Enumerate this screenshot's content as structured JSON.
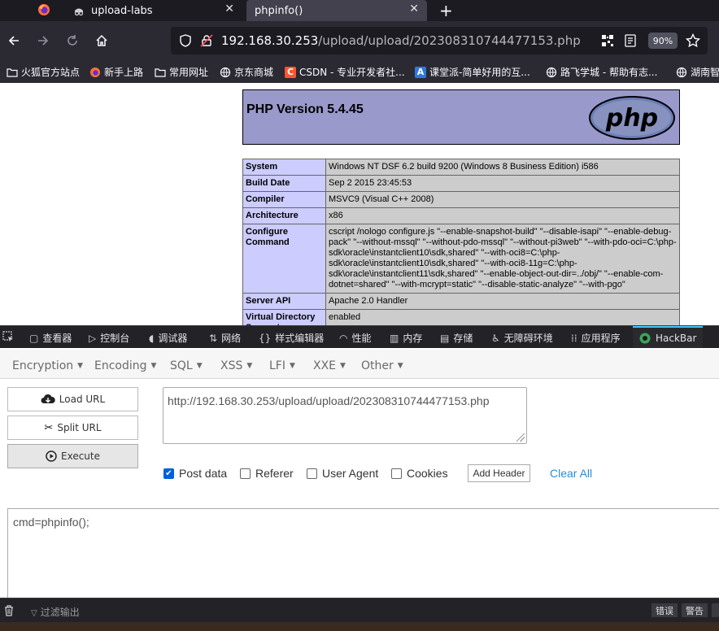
{
  "tabs": [
    {
      "label": "upload-labs"
    },
    {
      "label": "phpinfo()"
    }
  ],
  "url": {
    "host": "192.168.30.253",
    "path": "/upload/upload/202308310744477153.php",
    "zoom": "90%"
  },
  "bookmarks": [
    {
      "label": "火狐官方站点"
    },
    {
      "label": "新手上路"
    },
    {
      "label": "常用网址"
    },
    {
      "label": "京东商城"
    },
    {
      "label": "CSDN - 专业开发者社..."
    },
    {
      "label": "课堂派-简单好用的互..."
    },
    {
      "label": "路飞学城 - 帮助有志..."
    },
    {
      "label": "湖南智"
    }
  ],
  "phpinfo": {
    "title": "PHP Version 5.4.45",
    "logo_text": "php",
    "rows": [
      {
        "key": "System",
        "value": "Windows NT DSF 6.2 build 9200 (Windows 8 Business Edition) i586"
      },
      {
        "key": "Build Date",
        "value": "Sep 2 2015 23:45:53"
      },
      {
        "key": "Compiler",
        "value": "MSVC9 (Visual C++ 2008)"
      },
      {
        "key": "Architecture",
        "value": "x86"
      },
      {
        "key": "Configure Command",
        "value": "cscript /nologo configure.js \"--enable-snapshot-build\" \"--disable-isapi\" \"--enable-debug-pack\" \"--without-mssql\" \"--without-pdo-mssql\" \"--without-pi3web\" \"--with-pdo-oci=C:\\php-sdk\\oracle\\instantclient10\\sdk,shared\" \"--with-oci8=C:\\php-sdk\\oracle\\instantclient10\\sdk,shared\" \"--with-oci8-11g=C:\\php-sdk\\oracle\\instantclient11\\sdk,shared\" \"--enable-object-out-dir=../obj/\" \"--enable-com-dotnet=shared\" \"--with-mcrypt=static\" \"--disable-static-analyze\" \"--with-pgo\""
      },
      {
        "key": "Server API",
        "value": "Apache 2.0 Handler"
      },
      {
        "key": "Virtual Directory Support",
        "value": "enabled"
      }
    ]
  },
  "devtools": {
    "tabs": [
      "查看器",
      "控制台",
      "调试器",
      "网络",
      "样式编辑器",
      "性能",
      "内存",
      "存储",
      "无障碍环境",
      "应用程序",
      "HackBar"
    ]
  },
  "hackbar": {
    "menu": [
      "Encryption",
      "Encoding",
      "SQL",
      "XSS",
      "LFI",
      "XXE",
      "Other"
    ],
    "load_url": "Load URL",
    "split_url": "Split URL",
    "execute": "Execute",
    "url_value": "http://192.168.30.253/upload/upload/202308310744477153.php",
    "options": {
      "post_data": "Post data",
      "referer": "Referer",
      "user_agent": "User Agent",
      "cookies": "Cookies"
    },
    "add_header": "Add Header",
    "clear_all": "Clear All",
    "post_body": "cmd=phpinfo();"
  },
  "console": {
    "filter_placeholder": "过滤输出",
    "buttons": [
      "错误",
      "警告"
    ]
  }
}
